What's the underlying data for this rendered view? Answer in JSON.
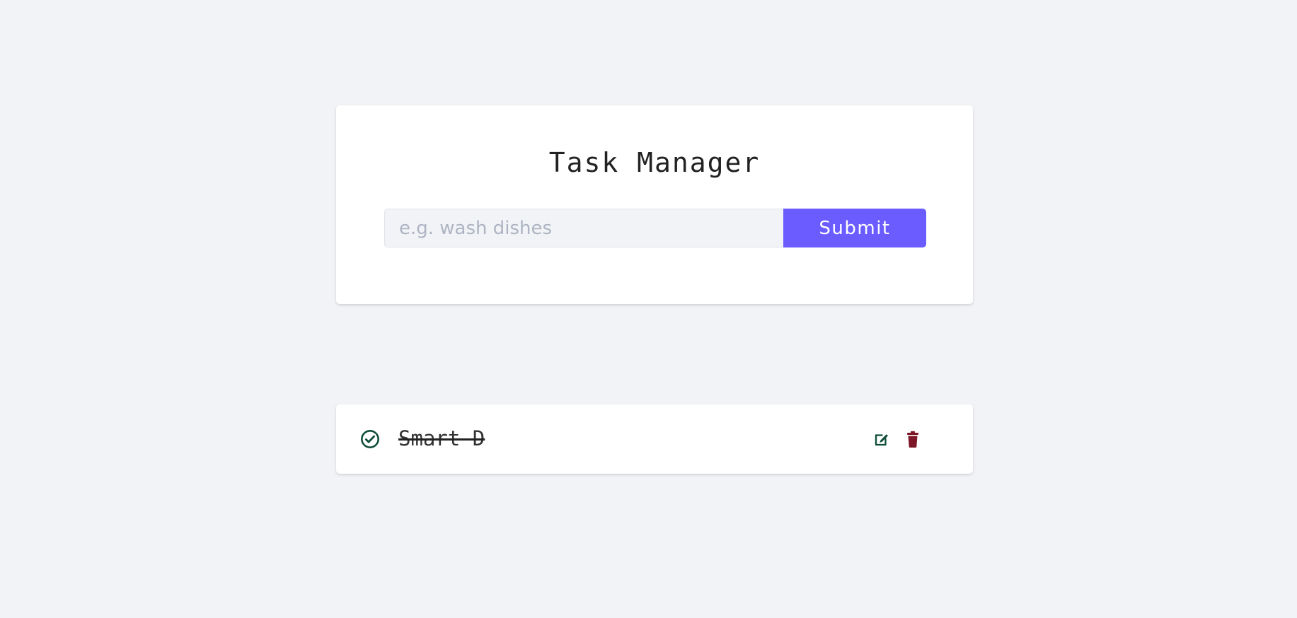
{
  "app": {
    "title": "Task Manager"
  },
  "form": {
    "input_value": "",
    "input_placeholder": "e.g. wash dishes",
    "submit_label": "Submit"
  },
  "tasks": [
    {
      "text": "Smart D",
      "completed": true,
      "status_icon": "check-circle-icon",
      "edit_icon": "edit-icon",
      "delete_icon": "trash-icon"
    }
  ],
  "colors": {
    "background": "#f1f3f7",
    "card": "#ffffff",
    "accent": "#6a5cff",
    "complete_icon": "#0f4d3a",
    "edit_icon": "#0f4d3a",
    "delete_icon": "#7d1727",
    "input_background": "#f1f3f7",
    "placeholder": "#aeb4c2",
    "title_text": "#222222"
  }
}
